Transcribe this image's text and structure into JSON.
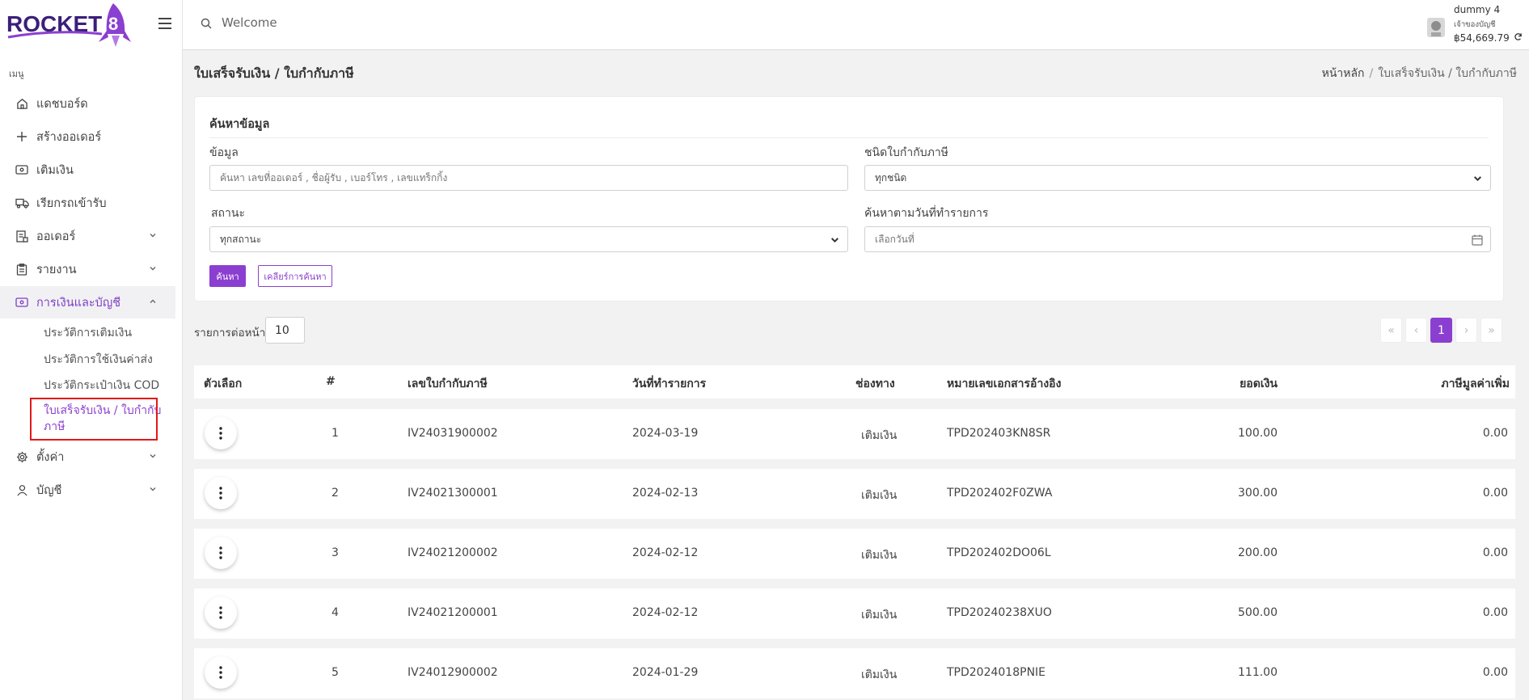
{
  "logo": {
    "text": "ROCKET",
    "number": "8"
  },
  "sidebar": {
    "heading": "เมนู",
    "items": [
      {
        "label": "แดชบอร์ด",
        "icon": "home-icon"
      },
      {
        "label": "สร้างออเดอร์",
        "icon": "plus-icon"
      },
      {
        "label": "เติมเงิน",
        "icon": "wallet-icon"
      },
      {
        "label": "เรียกรถเข้ารับ",
        "icon": "truck-icon"
      },
      {
        "label": "ออเดอร์",
        "icon": "orders-icon"
      },
      {
        "label": "รายงาน",
        "icon": "clipboard-icon"
      },
      {
        "label": "การเงินและบัญชี",
        "icon": "money-icon"
      },
      {
        "label": "ตั้งค่า",
        "icon": "gear-icon"
      },
      {
        "label": "บัญชี",
        "icon": "user-icon"
      }
    ],
    "finance_sub": [
      {
        "label": "ประวัติการเติมเงิน"
      },
      {
        "label": "ประวัติการใช้เงินค่าส่ง"
      },
      {
        "label": "ประวัติกระเป๋าเงิน COD"
      },
      {
        "label_line1": "ใบเสร็จรับเงิน / ใบกำกับ",
        "label_line2": "ภาษี"
      }
    ]
  },
  "topbar": {
    "search_text": "Welcome",
    "user_name": "dummy 4",
    "user_role": "เจ้าของบัญชี",
    "balance": "฿54,669.79"
  },
  "page": {
    "title": "ใบเสร็จรับเงิน / ใบกำกับภาษี",
    "breadcrumb_home": "หน้าหลัก",
    "breadcrumb_current": "ใบเสร็จรับเงิน / ใบกำกับภาษี"
  },
  "search_form": {
    "title": "ค้นหาข้อมูล",
    "data_label": "ข้อมูล",
    "data_placeholder": "ค้นหา เลขที่ออเดอร์ , ชื่อผู้รับ , เบอร์โทร , เลขแทร็กกิ้ง",
    "tax_type_label": "ชนิดใบกำกับภาษี",
    "tax_type_value": "ทุกชนิด",
    "status_label": "สถานะ",
    "status_value": "ทุกสถานะ",
    "date_label": "ค้นหาตามวันที่ทำรายการ",
    "date_placeholder": "เลือกวันที่",
    "search_button": "ค้นหา",
    "clear_button": "เคลียร์การค้นหา"
  },
  "list_controls": {
    "per_page_label": "รายการต่อหน้า",
    "per_page_value": "10",
    "pager": [
      "«",
      "‹",
      "1",
      "›",
      "»"
    ]
  },
  "table": {
    "headers": [
      "ตัวเลือก",
      "#",
      "เลขใบกำกับภาษี",
      "วันที่ทำรายการ",
      "ช่องทาง",
      "หมายเลขเอกสารอ้างอิง",
      "ยอดเงิน",
      "ภาษีมูลค่าเพิ่ม"
    ],
    "rows": [
      {
        "no": "1",
        "invoice": "IV24031900002",
        "date": "2024-03-19",
        "channel": "เติมเงิน",
        "ref": "TPD202403KN8SR",
        "amount": "100.00",
        "vat": "0.00"
      },
      {
        "no": "2",
        "invoice": "IV24021300001",
        "date": "2024-02-13",
        "channel": "เติมเงิน",
        "ref": "TPD202402F0ZWA",
        "amount": "300.00",
        "vat": "0.00"
      },
      {
        "no": "3",
        "invoice": "IV24021200002",
        "date": "2024-02-12",
        "channel": "เติมเงิน",
        "ref": "TPD202402DO06L",
        "amount": "200.00",
        "vat": "0.00"
      },
      {
        "no": "4",
        "invoice": "IV24021200001",
        "date": "2024-02-12",
        "channel": "เติมเงิน",
        "ref": "TPD20240238XUO",
        "amount": "500.00",
        "vat": "0.00"
      },
      {
        "no": "5",
        "invoice": "IV24012900002",
        "date": "2024-01-29",
        "channel": "เติมเงิน",
        "ref": "TPD2024018PNIE",
        "amount": "111.00",
        "vat": "0.00"
      }
    ]
  }
}
